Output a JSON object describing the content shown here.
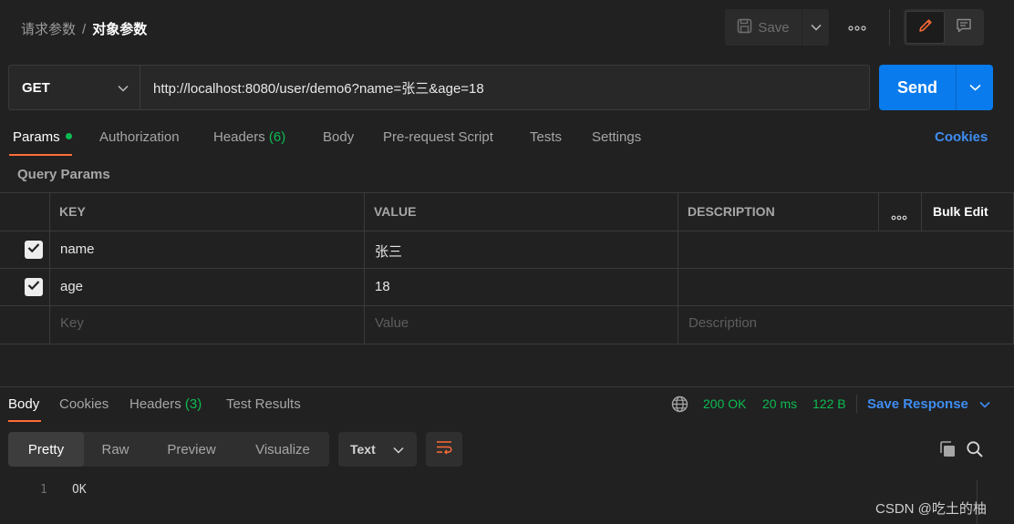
{
  "breadcrumb": {
    "parent": "请求参数",
    "separator": "/",
    "current": "对象参数"
  },
  "toolbar": {
    "save_label": "Save"
  },
  "request": {
    "method": "GET",
    "url": "http://localhost:8080/user/demo6?name=张三&age=18",
    "send_label": "Send"
  },
  "tabs": {
    "params": "Params",
    "authorization": "Authorization",
    "headers": "Headers",
    "headers_count": "(6)",
    "body": "Body",
    "prerequest": "Pre-request Script",
    "tests": "Tests",
    "settings": "Settings",
    "cookies": "Cookies"
  },
  "query_params": {
    "title": "Query Params",
    "columns": {
      "key": "KEY",
      "value": "VALUE",
      "description": "DESCRIPTION",
      "bulk_edit": "Bulk Edit"
    },
    "rows": [
      {
        "checked": true,
        "key": "name",
        "value": "张三",
        "description": ""
      },
      {
        "checked": true,
        "key": "age",
        "value": "18",
        "description": ""
      }
    ],
    "placeholder": {
      "key": "Key",
      "value": "Value",
      "description": "Description"
    }
  },
  "response": {
    "tabs": {
      "body": "Body",
      "cookies": "Cookies",
      "headers": "Headers",
      "headers_count": "(3)",
      "test_results": "Test Results"
    },
    "status": "200 OK",
    "time": "20 ms",
    "size": "122 B",
    "save_response": "Save Response",
    "views": {
      "pretty": "Pretty",
      "raw": "Raw",
      "preview": "Preview",
      "visualize": "Visualize"
    },
    "format": "Text",
    "line_number": "1",
    "body_text": "OK"
  },
  "watermark": "CSDN @吃土的柚",
  "colors": {
    "accent_orange": "#ff6c37",
    "send_blue": "#097bed",
    "link_blue": "#3f8df2",
    "status_green": "#0cbb52",
    "background": "#212121"
  },
  "icons": [
    "save-icon",
    "chevron-down-icon",
    "more-icon",
    "edit-icon",
    "comment-icon",
    "globe-icon",
    "wrap-lines-icon",
    "copy-icon",
    "search-icon",
    "checkbox-checked-icon"
  ]
}
